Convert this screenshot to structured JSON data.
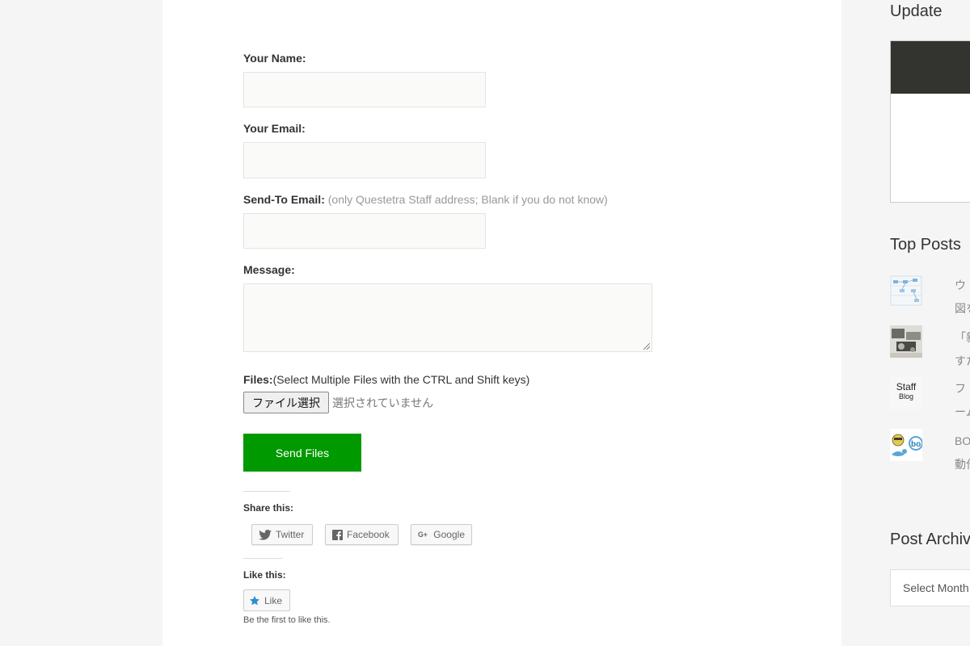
{
  "form": {
    "name_label": "Your Name:",
    "email_label": "Your Email:",
    "sendto_label": "Send-To Email:",
    "sendto_hint": "(only Questetra Staff address; Blank if you do not know)",
    "message_label": "Message:",
    "files_label": "Files:",
    "files_hint": "(Select Multiple Files with the CTRL and Shift keys)",
    "file_button": "ファイル選択",
    "file_status": "選択されていません",
    "send_button": "Send Files"
  },
  "share": {
    "heading": "Share this:",
    "buttons": [
      "Twitter",
      "Facebook",
      "Google"
    ]
  },
  "like": {
    "heading": "Like this:",
    "button": "Like",
    "note": "Be the first to like this."
  },
  "sidebar": {
    "update_heading": "Update",
    "top_posts_heading": "Top Posts",
    "posts": [
      {
        "line1": "ウ",
        "line2": "図を"
      },
      {
        "line1": "「新",
        "line2": "すた"
      },
      {
        "line1": "フ",
        "line2": "ーム"
      },
      {
        "line1": "BO",
        "line2": "動作"
      }
    ],
    "staff_thumb_line1": "Staff",
    "staff_thumb_line2": "Blog",
    "archive_heading": "Post Archive",
    "archive_select": "Select Month"
  },
  "colors": {
    "send_button": "#009900",
    "page_bg": "#f5f5f5",
    "content_bg": "#ffffff"
  }
}
